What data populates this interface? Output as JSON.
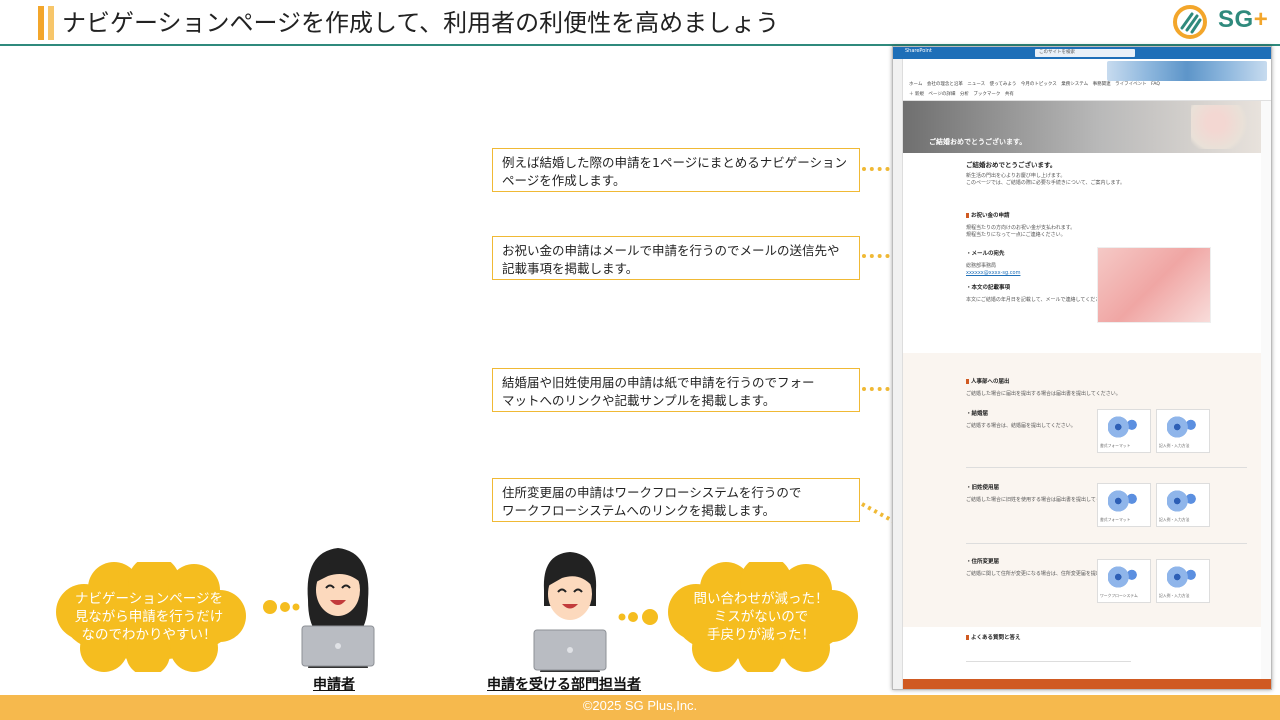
{
  "header": {
    "title": "ナビゲーションページを作成して、利用者の利便性を高めましょう",
    "logo_text": "SG",
    "logo_plus": "+"
  },
  "callouts": [
    {
      "line1": "例えば結婚した際の申請を1ページにまとめるナビゲーション",
      "line2": "ページを作成します。"
    },
    {
      "line1": "お祝い金の申請はメールで申請を行うのでメールの送信先や",
      "line2": "記載事項を掲載します。"
    },
    {
      "line1": "結婚届や旧姓使用届の申請は紙で申請を行うのでフォー",
      "line2": "マットへのリンクや記載サンプルを掲載します。"
    },
    {
      "line1": "住所変更届の申請はワークフローシステムを行うので",
      "line2": "ワークフローシステムへのリンクを掲載します。"
    }
  ],
  "screenshot": {
    "app_name": "SharePoint",
    "search_placeholder": "このサイトを検索",
    "nav_row1": "ホーム　会社の理念と沿革　ニュース　使ってみよう　今月のトピックス　業務システム　事務関連　ライフイベント　FAQ",
    "nav_row2": "＋ 新規　ページの詳細　分析　ブックマーク　共有",
    "hero_title": "ご結婚おめでとうございます。",
    "intro_heading": "ご結婚おめでとうございます。",
    "intro_text1": "新生活の門出を心よりお慶び申し上げます。",
    "intro_text2": "このページでは、ご結婚の際に必要な手続きについて、ご案内します。",
    "gift_heading": "お祝い金の申請",
    "gift_text1": "規程当たりの方向けのお祝い金が支払われます。",
    "gift_text2": "規程当たりになって一点にご連絡ください。",
    "mail_heading": "・メールの宛先",
    "mail_label": "総務部事務局",
    "mail_address": "xxxxxx@xxxx-sg.com",
    "content_heading": "・本文の記載事項",
    "content_text": "本文にご結婚の年月日を記載して、メールで連絡してください。",
    "hr_heading": "人事部への届出",
    "hr_text": "ご結婚した場合に届出を提出する場合は届出書を提出してください。",
    "marriage_heading": "・結婚届",
    "marriage_text": "ご結婚する場合は、結婚届を提出してください。",
    "oldname_heading": "・旧姓使用届",
    "oldname_text": "ご結婚した場合に旧姓を使用する場合は届出書を提出してください。",
    "address_heading": "・住所変更届",
    "address_text": "ご結婚に関して住所が変更になる場合は、住所変更届を提出してください。",
    "card_format": "書式フォーマット",
    "card_sample": "記入例・入力方法",
    "card_workflow": "ワークフローシステム",
    "faq_heading": "よくある質問と答え"
  },
  "characters": [
    {
      "label": "申請者"
    },
    {
      "label": "申請を受ける部門担当者"
    }
  ],
  "bubbles": [
    {
      "line1": "ナビゲーションページを",
      "line2": "見ながら申請を行うだけ",
      "line3": "なのでわかりやすい！"
    },
    {
      "line1": "問い合わせが減った！",
      "line2": "ミスがないので",
      "line3": "手戻りが減った！"
    }
  ],
  "footer": {
    "copyright": "©2025 SG Plus,Inc."
  },
  "colors": {
    "accent": "#f3a62b",
    "callout_border": "#f0b935",
    "rule": "#2f8a7d",
    "sharepoint": "#1e6fb8",
    "footer": "#f6b94d"
  }
}
